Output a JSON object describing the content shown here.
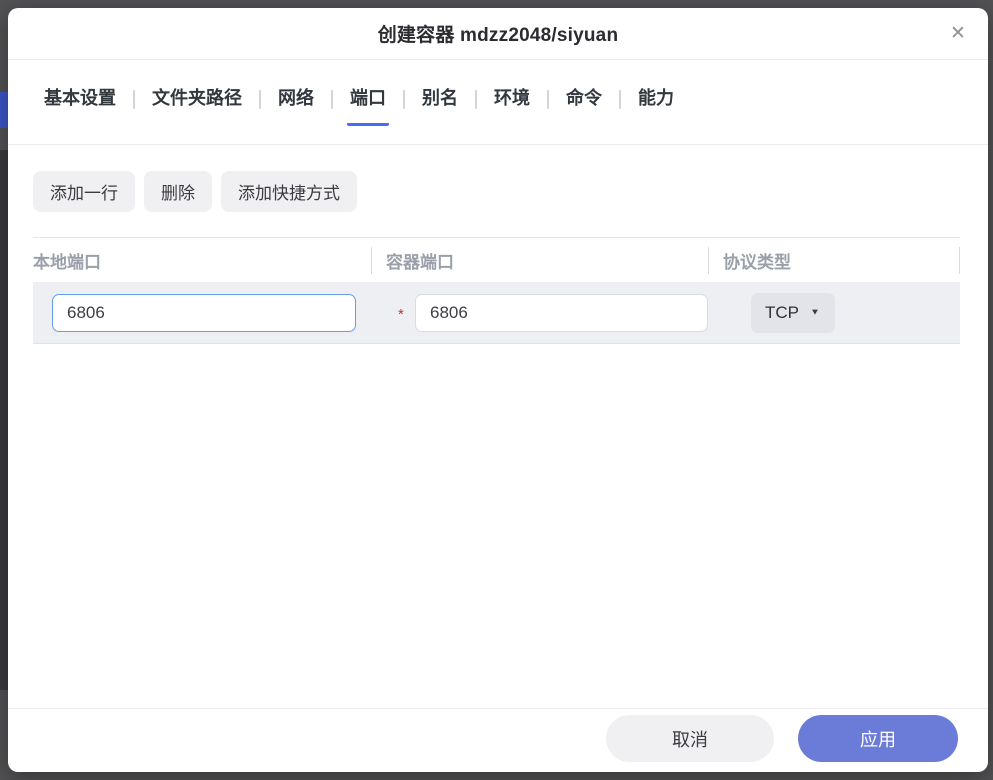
{
  "dialog": {
    "title": "创建容器 mdzz2048/siyuan",
    "close_icon": "✕"
  },
  "tabs": [
    {
      "label": "基本设置",
      "active": false
    },
    {
      "label": "文件夹路径",
      "active": false
    },
    {
      "label": "网络",
      "active": false
    },
    {
      "label": "端口",
      "active": true
    },
    {
      "label": "别名",
      "active": false
    },
    {
      "label": "环境",
      "active": false
    },
    {
      "label": "命令",
      "active": false
    },
    {
      "label": "能力",
      "active": false
    }
  ],
  "toolbar": {
    "add_row_label": "添加一行",
    "delete_label": "删除",
    "add_shortcut_label": "添加快捷方式"
  },
  "table": {
    "headers": [
      "本地端口",
      "容器端口",
      "协议类型"
    ],
    "rows": [
      {
        "local_port": "6806",
        "required_marker": "*",
        "container_port": "6806",
        "protocol": {
          "value": "TCP",
          "dropdown_icon": "▼"
        }
      }
    ]
  },
  "footer": {
    "cancel_label": "取消",
    "apply_label": "应用"
  },
  "colors": {
    "active_tab_underline": "#4a6bf5",
    "apply_button": "#6b7cd8",
    "focused_input_border": "#64a0e6",
    "required_marker": "#c0392b",
    "row_background": "#edeff3",
    "backdrop": "#525254"
  }
}
